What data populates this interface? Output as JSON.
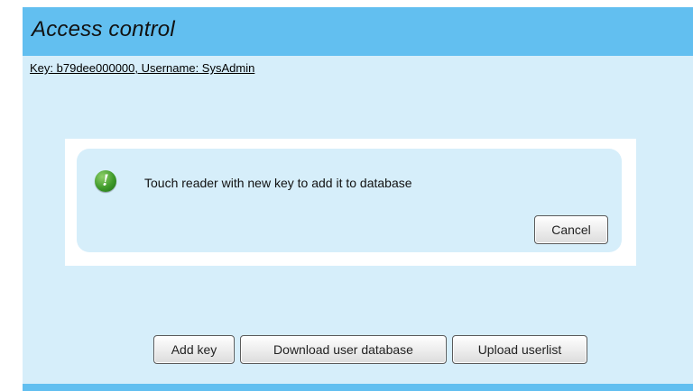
{
  "header": {
    "title": "Access control"
  },
  "key_info": "Key: b79dee000000, Username: SysAdmin",
  "dialog": {
    "icon": "alert-exclamation-icon",
    "message": "Touch reader with new key to add it to database",
    "cancel_label": "Cancel"
  },
  "actions": {
    "add_key_label": "Add key",
    "download_label": "Download user database",
    "upload_label": "Upload userlist"
  },
  "colors": {
    "header_bg": "#62bff0",
    "panel_bg": "#d6eefa",
    "icon_green": "#3f9a2a"
  }
}
